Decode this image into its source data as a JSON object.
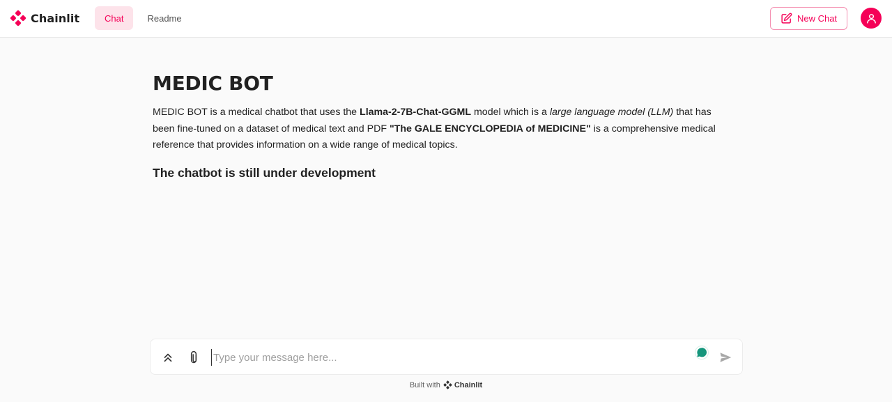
{
  "header": {
    "app_name": "Chainlit",
    "tabs": [
      {
        "label": "Chat",
        "active": true
      },
      {
        "label": "Readme",
        "active": false
      }
    ],
    "new_chat_label": "New Chat"
  },
  "readme": {
    "title": "MEDIC BOT",
    "desc": {
      "p1": "MEDIC BOT  is a medical chatbot that uses the ",
      "model_name": "Llama-2-7B-Chat-GGML",
      "p2": " model which is a ",
      "model_type": "large language model (LLM)",
      "p3": " that has been fine-tuned on a dataset of medical text and PDF ",
      "source_name": "\"The GALE ENCYCLOPEDIA of MEDICINE\"",
      "p4": " is a comprehensive medical reference that provides information on a wide range of medical topics."
    },
    "subheading": "The chatbot is still under development"
  },
  "composer": {
    "placeholder": "Type your message here..."
  },
  "footer": {
    "built_with": "Built with",
    "brand": "Chainlit"
  },
  "colors": {
    "accent": "#f50057",
    "accent_light": "#fde3ea",
    "background": "#fafafa",
    "grammar_badge": "#15967c"
  }
}
